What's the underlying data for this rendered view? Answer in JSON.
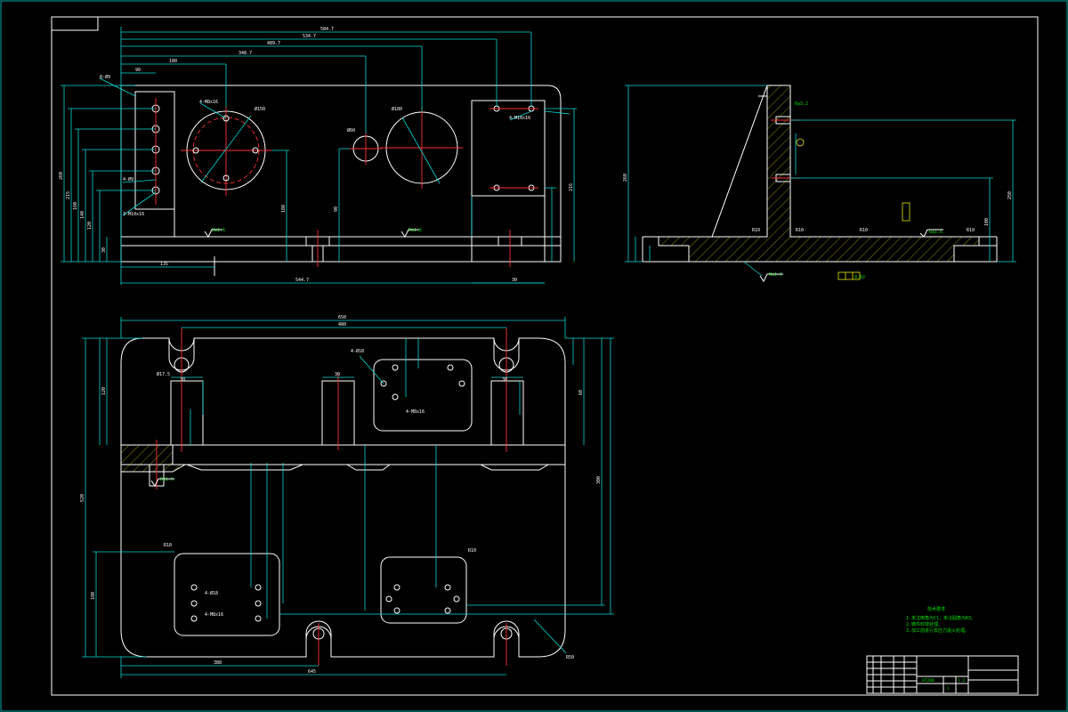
{
  "drawing": {
    "top_view_dims": {
      "d1": "584.7",
      "d2": "534.7",
      "d3": "489.7",
      "d4": "348.7",
      "d5": "180",
      "d6": "90",
      "d7": "135",
      "d8": "544.7",
      "d9": "30",
      "d10": "216",
      "d11": "180",
      "d12": "90",
      "v1": "260",
      "v2": "215",
      "v3": "160",
      "v4": "140",
      "v5": "120",
      "v6": "30",
      "dia1": "Ø150",
      "dia2": "Ø180",
      "dia3": "Ø60",
      "n1": "4-M8x16",
      "n2": "4-Ø9",
      "n3": "3-M10x16",
      "n4": "4-M10x16",
      "n5": "Ra1.6",
      "n6": "Ra1.6",
      "n7": "8-Ø9"
    },
    "side_view_dims": {
      "h1": "260",
      "h2": "250",
      "h3": "100",
      "r1": "R10",
      "r2": "R10",
      "r3": "R10",
      "r4": "R10",
      "n1": "Ra1.6",
      "n2": "Ra1.6",
      "n3": "Ra3.2",
      "n4": "0.02"
    },
    "plan_view_dims": {
      "w1": "650",
      "w2": "480",
      "w3": "30",
      "w4": "30",
      "w5": "30",
      "h1": "520",
      "h2": "300",
      "h3": "180",
      "h4": "120",
      "h5": "60",
      "b1": "388",
      "b2": "645",
      "n1": "4-Ø18",
      "n2": "4-M8x16",
      "n3": "4-Ø18",
      "n4": "R10",
      "n5": "R10",
      "n6": "R50",
      "n7": "Ø17.5",
      "n8": "Ra1.6",
      "n9": "4-M8x16"
    },
    "tech_requirements": {
      "title": "技术要求",
      "line1": "1.未注倒角为C1，未注圆角为R3。",
      "line2": "2.铸件时效处理。",
      "line3": "3.加工前进行去应力退火处理。"
    }
  },
  "title_block": {
    "scale": "1:2",
    "sheet": "1",
    "material": "HT200"
  },
  "colors": {
    "outline": "#ffffff",
    "dimension": "#00d8d8",
    "centerline": "#ff3030",
    "hatch": "#e8e800",
    "note": "#00e000"
  }
}
